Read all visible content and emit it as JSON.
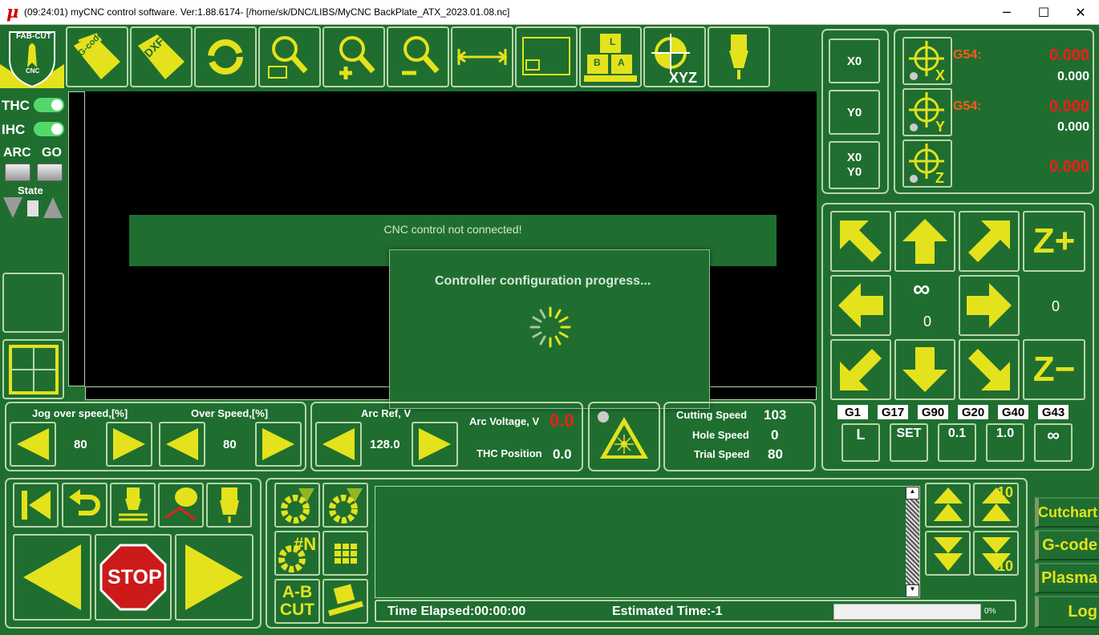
{
  "titlebar": {
    "icon": "μ",
    "text": "(09:24:01)    myCNC control software. Ver:1.88.6174-    [/home/sk/DNC/LIBS/MyCNC BackPlate_ATX_2023.01.08.nc]",
    "min": "─",
    "max": "☐",
    "close": "✕"
  },
  "logo": {
    "text": "FAB-CUT",
    "sub": "CNC"
  },
  "toolbar": {
    "gcode": "G-code",
    "dxf": "DXF",
    "xyz": "XYZ",
    "keys": [
      "L",
      "B",
      "A"
    ]
  },
  "left": {
    "thc": "THC",
    "ihc": "IHC",
    "arc": "ARC",
    "go": "GO",
    "state": "State"
  },
  "viewport": {
    "banner": "CNC control not connected!"
  },
  "dialog": {
    "title": "Controller configuration progress..."
  },
  "coords": {
    "x_btn": "X0",
    "y_btn": "Y0",
    "xy_btn1": "X0",
    "xy_btn2": "Y0",
    "x_axis": "X",
    "y_axis": "Y",
    "z_axis": "Z",
    "x_cs": "G54:",
    "y_cs": "G54:",
    "x_val": "0.000",
    "x_sub": "0.000",
    "y_val": "0.000",
    "y_sub": "0.000",
    "z_val": "0.000"
  },
  "jog": {
    "zplus": "Z+",
    "zminus": "Z−",
    "infinity": "∞",
    "center_val": "0",
    "side_val": "0"
  },
  "gcodes": [
    "G1",
    "G17",
    "G90",
    "G20",
    "G40",
    "G43"
  ],
  "step_buttons": [
    "L",
    "SET",
    "0.1",
    "1.0",
    "∞"
  ],
  "overspeed": {
    "jog_label": "Jog over speed,[%]",
    "jog_val": "80",
    "over_label": "Over Speed,[%]",
    "over_val": "80"
  },
  "arc": {
    "ref_label": "Arc Ref, V",
    "ref_val": "128.0",
    "voltage_label": "Arc Voltage, V",
    "voltage_val": "0.0",
    "thc_pos_label": "THC Position",
    "thc_pos_val": "0.0"
  },
  "speeds": {
    "cutting_label": "Cutting Speed",
    "cutting_val": "103",
    "hole_label": "Hole Speed",
    "hole_val": "0",
    "trial_label": "Trial Speed",
    "trial_val": "80"
  },
  "controls": {
    "stop": "STOP"
  },
  "midtools": {
    "n": "#N",
    "ab": "A-B",
    "cut": "CUT"
  },
  "status": {
    "elapsed": "Time Elapsed:00:00:00",
    "estimated": "Estimated Time:-1",
    "progress": "0%",
    "progress_value": 0
  },
  "scroll": {
    "up10": "10",
    "down10": "10"
  },
  "sidetabs": [
    "Cutchart",
    "G-code",
    "Plasma",
    "Log"
  ],
  "colors": {
    "bg": "#1f6e30",
    "yellow": "#e4e21c",
    "border": "#b9d6a8",
    "red": "#ff1a1a"
  }
}
